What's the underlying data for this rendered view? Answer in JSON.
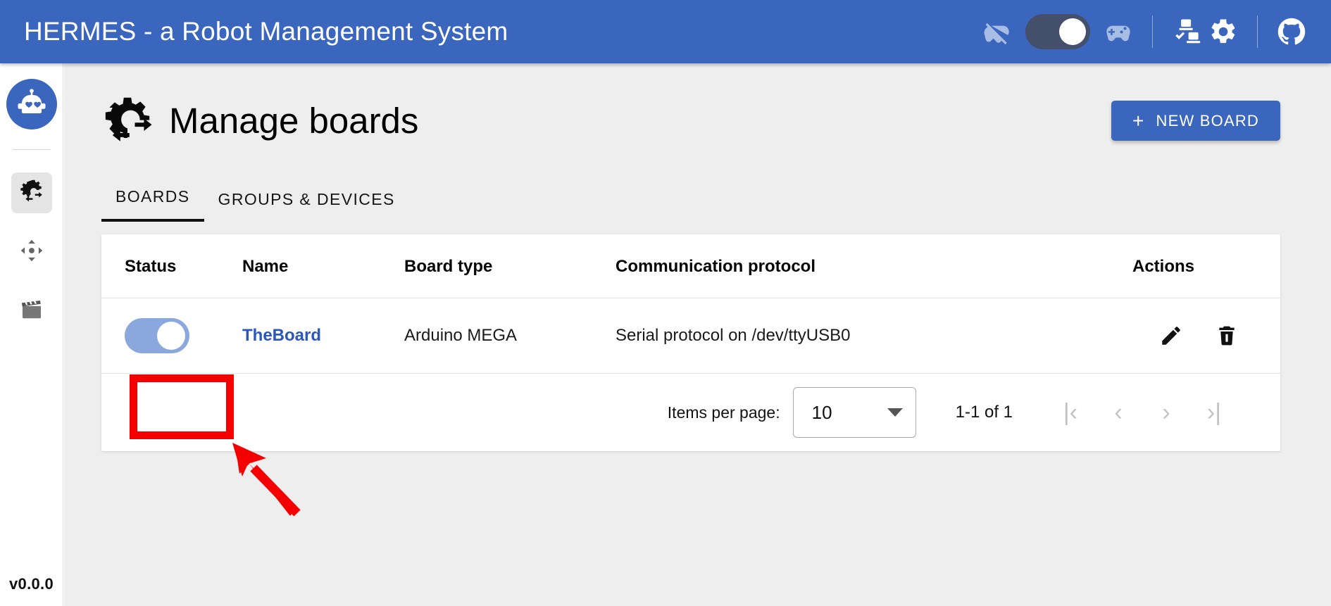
{
  "header": {
    "title": "HERMES - a Robot Management System",
    "icons": [
      {
        "name": "gamepad-off-icon",
        "label": "gamepad disabled"
      },
      {
        "name": "gamepad-toggle",
        "label": "gamepad mode toggle",
        "state": "on"
      },
      {
        "name": "gamepad-icon",
        "label": "gamepad enabled"
      },
      {
        "name": "device-status-icon",
        "label": "devices status"
      },
      {
        "name": "gear-icon",
        "label": "settings"
      },
      {
        "name": "github-icon",
        "label": "github repository"
      }
    ],
    "accent_color": "#3a66bd",
    "toggle_track_color": "#434f6b"
  },
  "sidebar": {
    "avatar_label": "robot-avatar",
    "items": [
      {
        "name": "sidebar-item-boards",
        "icon": "gear-exchange-icon",
        "active": true
      },
      {
        "name": "sidebar-item-control",
        "icon": "move-arrows-icon",
        "active": false
      },
      {
        "name": "sidebar-item-scenes",
        "icon": "clapperboard-icon",
        "active": false
      }
    ],
    "version": "v0.0.0"
  },
  "main": {
    "page_title": "Manage boards",
    "page_title_icon": "gear-exchange-icon",
    "new_board_button": {
      "plus": "+",
      "label": "NEW BOARD"
    },
    "tabs": [
      {
        "label": "BOARDS",
        "active": true
      },
      {
        "label": "GROUPS & DEVICES",
        "active": false
      }
    ],
    "table": {
      "columns": [
        "Status",
        "Name",
        "Board type",
        "Communication protocol",
        "Actions"
      ],
      "rows": [
        {
          "status": {
            "state": "on",
            "color": "#8ba8de"
          },
          "name": "TheBoard",
          "board_type": "Arduino MEGA",
          "protocol": "Serial protocol on /dev/ttyUSB0",
          "actions": [
            {
              "name": "edit-board-button",
              "icon": "pencil-icon"
            },
            {
              "name": "delete-board-button",
              "icon": "trash-icon"
            }
          ]
        }
      ]
    },
    "paginator": {
      "items_per_page_label": "Items per page:",
      "items_per_page_value": "10",
      "range_label": "1-1 of 1",
      "buttons": [
        {
          "name": "first-page-button",
          "glyph": "|‹"
        },
        {
          "name": "previous-page-button",
          "glyph": "‹"
        },
        {
          "name": "next-page-button",
          "glyph": "›"
        },
        {
          "name": "last-page-button",
          "glyph": "›|"
        }
      ]
    }
  },
  "annotations": {
    "highlight_color": "#f40000",
    "highlight_target": "board-status-toggle",
    "arrow_target": "board-status-toggle"
  }
}
